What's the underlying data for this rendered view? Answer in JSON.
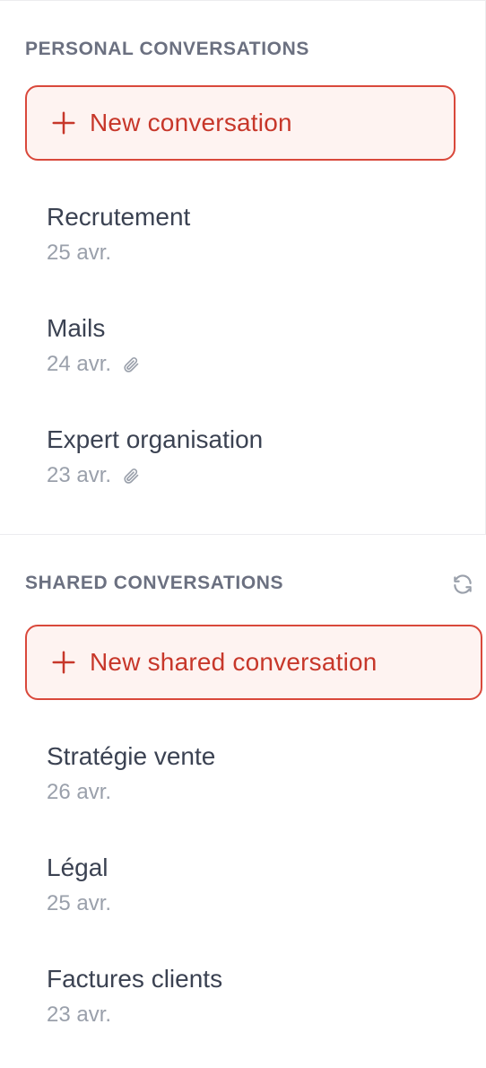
{
  "personal": {
    "header": "PERSONAL CONVERSATIONS",
    "new_button_label": "New conversation",
    "items": [
      {
        "title": "Recrutement",
        "date": "25 avr.",
        "attachment": false
      },
      {
        "title": "Mails",
        "date": "24 avr.",
        "attachment": true
      },
      {
        "title": "Expert organisation",
        "date": "23 avr.",
        "attachment": true
      }
    ]
  },
  "shared": {
    "header": "SHARED CONVERSATIONS",
    "new_button_label": "New shared conversation",
    "refresh_icon": "refresh-icon",
    "items": [
      {
        "title": "Stratégie vente",
        "date": "26 avr."
      },
      {
        "title": "Légal",
        "date": "25 avr."
      },
      {
        "title": "Factures clients",
        "date": "23 avr."
      }
    ]
  },
  "colors": {
    "accent": "#c7372a",
    "accent_border": "#d9483b",
    "accent_bg": "#fef3f1",
    "header_text": "#6b7080",
    "title_text": "#3b4252",
    "meta_text": "#9aa0ab"
  }
}
